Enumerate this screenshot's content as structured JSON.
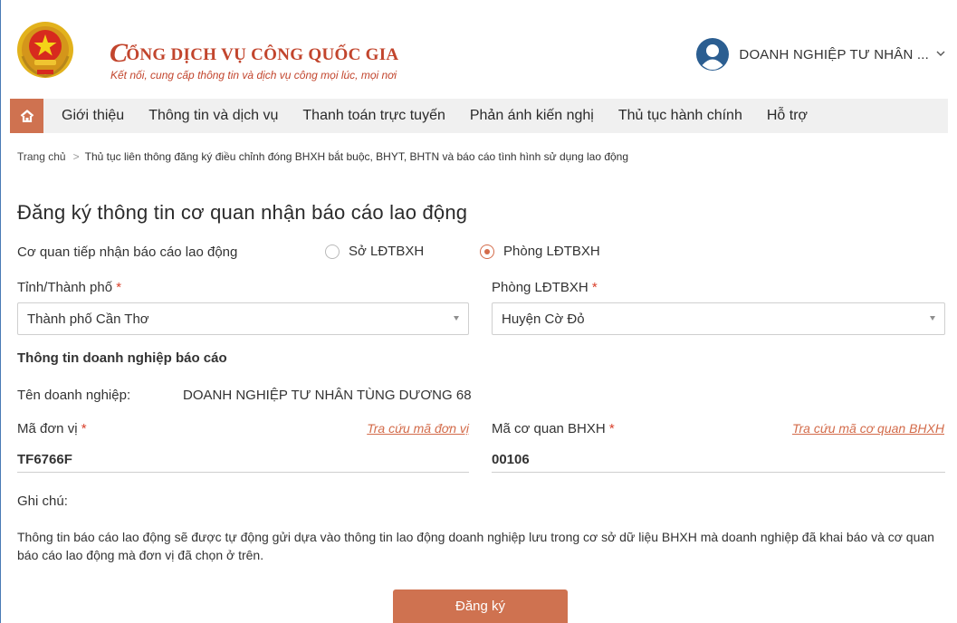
{
  "brand": {
    "title_initial": "C",
    "title_rest": "ỔNG DỊCH VỤ CÔNG QUỐC GIA",
    "subtitle": "Kết nối, cung cấp thông tin và dịch vụ công mọi lúc, mọi nơi"
  },
  "user": {
    "name": "DOANH NGHIỆP TƯ NHÂN ...",
    "caret": "⌄"
  },
  "colors": {
    "accent": "#cf7250",
    "brand_red": "#c2452d",
    "avatar_blue": "#2b5e91"
  },
  "nav": {
    "home_icon": "home-icon",
    "items": [
      "Giới thiệu",
      "Thông tin và dịch vụ",
      "Thanh toán trực tuyến",
      "Phản ánh kiến nghị",
      "Thủ tục hành chính",
      "Hỗ trợ"
    ]
  },
  "breadcrumb": {
    "home": "Trang chủ",
    "separator": ">",
    "current": "Thủ tục liên thông đăng ký điều chỉnh đóng BHXH bắt buộc, BHYT, BHTN và báo cáo tình hình sử dụng lao động"
  },
  "form": {
    "title": "Đăng ký thông tin cơ quan nhận báo cáo lao động",
    "agency_label": "Cơ quan tiếp nhận báo cáo lao động",
    "radio_options": [
      "Sở LĐTBXH",
      "Phòng LĐTBXH"
    ],
    "selected_radio": "Phòng LĐTBXH",
    "province_label": "Tỉnh/Thành phố",
    "province_value": "Thành phố Cần Thơ",
    "office_label": "Phòng LĐTBXH",
    "office_value": "Huyện Cờ Đỏ",
    "required_mark": "*",
    "section_title": "Thông tin doanh nghiệp báo cáo",
    "company_label": "Tên doanh nghiệp:",
    "company_value": "DOANH NGHIỆP TƯ NHÂN TÙNG DƯƠNG 68",
    "unit_code_label": "Mã đơn vị",
    "unit_code_link": "Tra cứu mã đơn vị",
    "unit_code_value": "TF6766F",
    "agency_code_label": "Mã cơ quan BHXH",
    "agency_code_link": "Tra cứu mã cơ quan BHXH",
    "agency_code_value": "00106",
    "note_label": "Ghi chú:",
    "note_text": "Thông tin báo cáo lao động sẽ được tự động gửi dựa vào thông tin lao động doanh nghiệp lưu trong cơ sở dữ liệu BHXH mà doanh nghiệp đã khai báo và cơ quan báo cáo lao động mà đơn vị đã chọn ở trên.",
    "submit_label": "Đăng ký"
  }
}
